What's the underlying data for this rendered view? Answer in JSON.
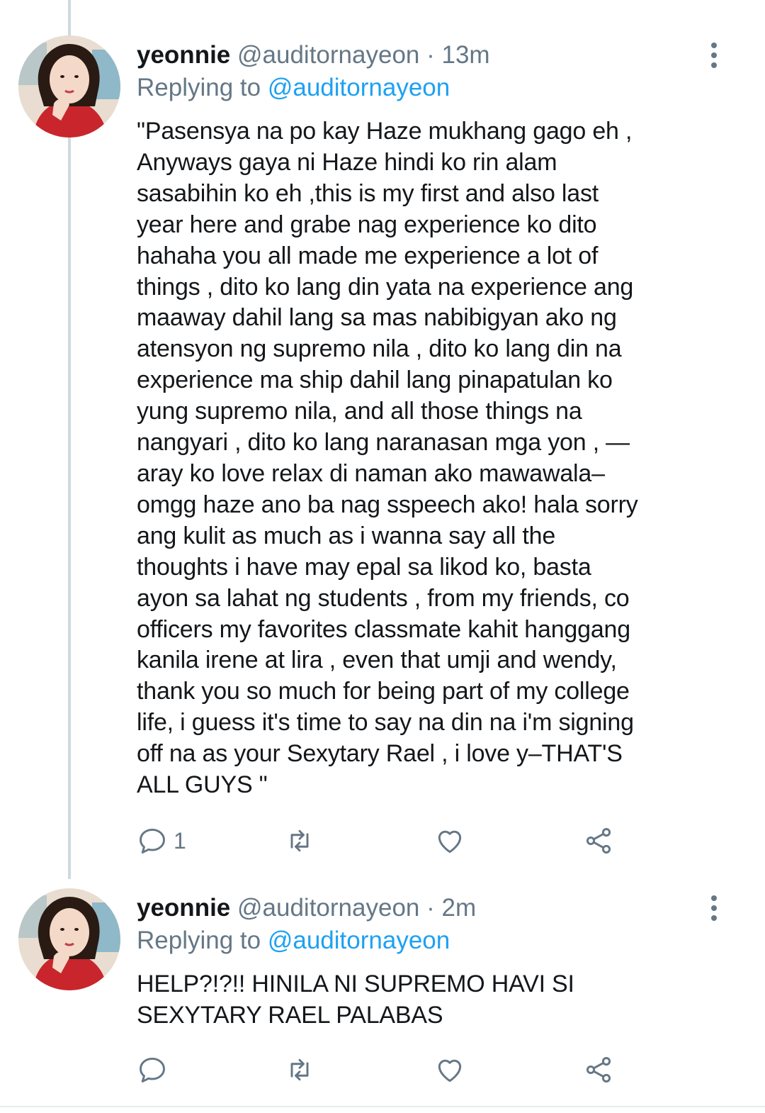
{
  "tweets": [
    {
      "display_name": "yeonnie",
      "handle": "@auditornayeon",
      "separator": "·",
      "time": "13m",
      "replying_prefix": "Replying to",
      "replying_to": "@auditornayeon",
      "text": "\"Pasensya na po kay Haze mukhang gago eh ,\nAnyways gaya ni Haze hindi ko rin alam\nsasabihin ko eh ,this is my first and also last\nyear here and grabe nag experience ko dito\nhahaha you all made me experience a lot of\nthings , dito ko lang din yata na experience ang\nmaaway dahil lang sa mas nabibigyan ako ng\natensyon ng supremo nila , dito ko lang din na\nexperience ma ship dahil lang pinapatulan ko\nyung supremo nila, and all those things na\nnangyari , dito ko lang naranasan mga yon , —\naray ko love relax di naman ako mawawala–\nomgg haze ano ba nag sspeech ako! hala sorry\nang kulit as much as i wanna say all the\nthoughts i have may epal sa likod ko, basta\nayon sa lahat ng students , from my friends, co\nofficers my favorites classmate kahit hanggang\nkanila irene at lira , even that umji and wendy,\nthank you so much for being part of my college\nlife, i guess it's time to say na din na i'm signing\noff na as your Sexytary Rael , i love y–THAT'S\nALL GUYS \"",
      "reply_count": "1",
      "icons": {
        "reply": "reply-icon",
        "retweet": "retweet-icon",
        "like": "heart-icon",
        "share": "share-icon",
        "more": "more-vertical-icon"
      }
    },
    {
      "display_name": "yeonnie",
      "handle": "@auditornayeon",
      "separator": "·",
      "time": "2m",
      "replying_prefix": "Replying to",
      "replying_to": "@auditornayeon",
      "text": "HELP?!?!! HINILA NI SUPREMO HAVI SI\nSEXYTARY RAEL PALABAS",
      "reply_count": "",
      "icons": {
        "reply": "reply-icon",
        "retweet": "retweet-icon",
        "like": "heart-icon",
        "share": "share-icon",
        "more": "more-vertical-icon"
      }
    }
  ],
  "colors": {
    "text": "#14171a",
    "muted": "#657786",
    "link": "#1da1f2",
    "thread_line": "#cfd9de"
  }
}
